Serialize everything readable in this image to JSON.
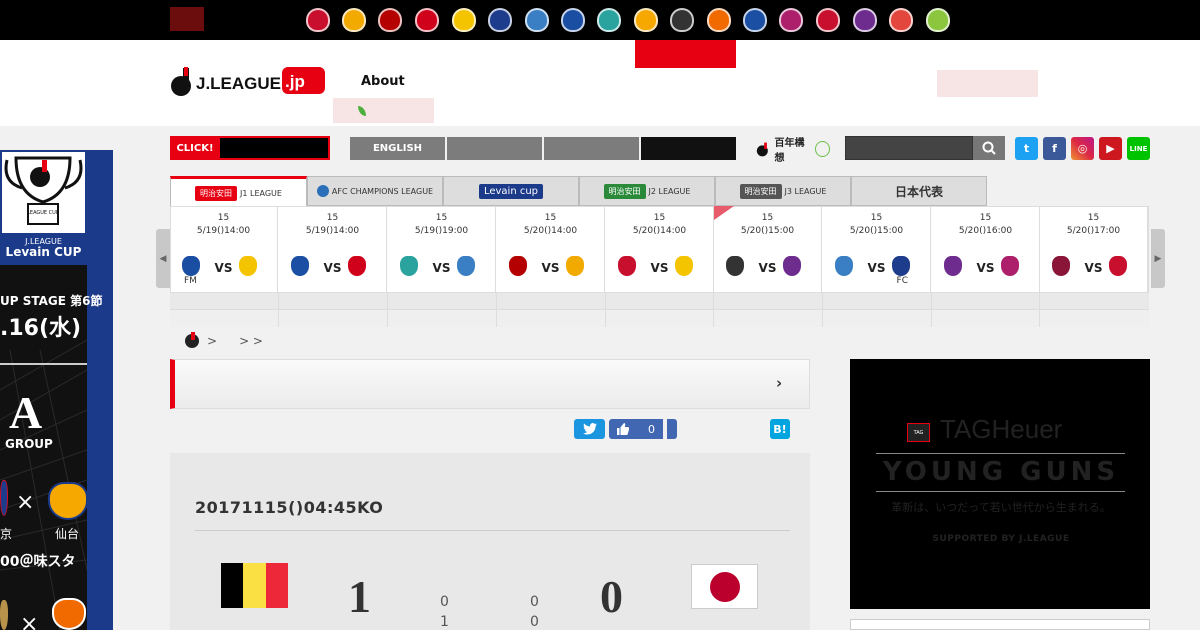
{
  "topbar": {
    "tabs": [
      " ",
      " ",
      " "
    ],
    "club_colors": [
      "#c8102e",
      "#f2a900",
      "#b40000",
      "#d0021b",
      "#f5c400",
      "#1e3c8c",
      "#3a7fc4",
      "#1a4ea2",
      "#2aa39e",
      "#f6a800",
      "#333333",
      "#f06a00",
      "#1b4fa3",
      "#ad1f6b",
      "#c8102e",
      "#6e2c8f",
      "#e2463c",
      "#8cc63f"
    ]
  },
  "header": {
    "logo_text": "J.LEAGUE",
    "logo_suffix": ".jp",
    "about": "About",
    "login": " ",
    "green_link": " "
  },
  "nav2": {
    "click_label": "CLICK!",
    "click_text": " ",
    "english": "ENGLISH",
    "hyakunen": "百年構想",
    "search_placeholder": "",
    "sns": [
      "t",
      "f",
      "◎",
      "▶",
      "LINE"
    ]
  },
  "league_tabs": {
    "j1": "J1 LEAGUE",
    "acl": "AFC CHAMPIONS LEAGUE",
    "levain": "Levain cup",
    "j2": "J2 LEAGUE",
    "j3": "J3 LEAGUE",
    "japan": "日本代表"
  },
  "matches": [
    {
      "num": "15",
      "dt": "5/19()14:00",
      "vs": "VS",
      "home_sub": "FM",
      "away_sub": "",
      "home_color": "#1a4ea2",
      "away_color": "#f5c400"
    },
    {
      "num": "15",
      "dt": "5/19()14:00",
      "vs": "VS",
      "home_sub": "",
      "away_sub": "",
      "home_color": "#1b4fa3",
      "away_color": "#d0021b"
    },
    {
      "num": "15",
      "dt": "5/19()19:00",
      "vs": "VS",
      "home_sub": "",
      "away_sub": "",
      "home_color": "#2aa39e",
      "away_color": "#3a7fc4"
    },
    {
      "num": "15",
      "dt": "5/20()14:00",
      "vs": "VS",
      "home_sub": "",
      "away_sub": "",
      "home_color": "#b40000",
      "away_color": "#f2a900"
    },
    {
      "num": "15",
      "dt": "5/20()14:00",
      "vs": "VS",
      "home_sub": "",
      "away_sub": "",
      "home_color": "#c8102e",
      "away_color": "#f5c400"
    },
    {
      "num": "15",
      "dt": "5/20()15:00",
      "vs": "VS",
      "home_sub": "",
      "away_sub": "",
      "home_color": "#333333",
      "away_color": "#6e2c8f"
    },
    {
      "num": "15",
      "dt": "5/20()15:00",
      "vs": "VS",
      "home_sub": "",
      "away_sub": "FC",
      "home_color": "#3a7fc4",
      "away_color": "#1e3c8c"
    },
    {
      "num": "15",
      "dt": "5/20()16:00",
      "vs": "VS",
      "home_sub": "",
      "away_sub": "",
      "home_color": "#6e2c8f",
      "away_color": "#ad1f6b"
    },
    {
      "num": "15",
      "dt": "5/20()17:00",
      "vs": "VS",
      "home_sub": "",
      "away_sub": "",
      "home_color": "#8a1538",
      "away_color": "#c8102e"
    }
  ],
  "breadcrumb": {
    "sep1": ">",
    "sep2": "> >"
  },
  "headline": {
    "text": "",
    "arrow": "›"
  },
  "share": {
    "fb_count": "0",
    "hb": "B!"
  },
  "match": {
    "title": "20171115()04:45KO",
    "home_score": "1",
    "away_score": "0",
    "home_half1": "0",
    "home_half2": "1",
    "away_half1": "0",
    "away_half2": "0"
  },
  "ad": {
    "brand": "TAGHeuer",
    "tag_small": "TAG",
    "title": "YOUNG GUNS",
    "tagline": "革新は、いつだって若い世代から生まれる。",
    "supported": "SUPPORTED BY J.LEAGUE"
  },
  "banner": {
    "cup_top": "J.LEAGUE",
    "cup_name": "Levain CUP",
    "badge_text": "LEAGUE CUP",
    "stage": "UP STAGE 第6節",
    "date": ".16(水)",
    "group_letter": "A",
    "group_label": "GROUP",
    "x_mark": "×",
    "team1": "京",
    "team2": "仙台",
    "time_venue": "00＠味スタ"
  }
}
